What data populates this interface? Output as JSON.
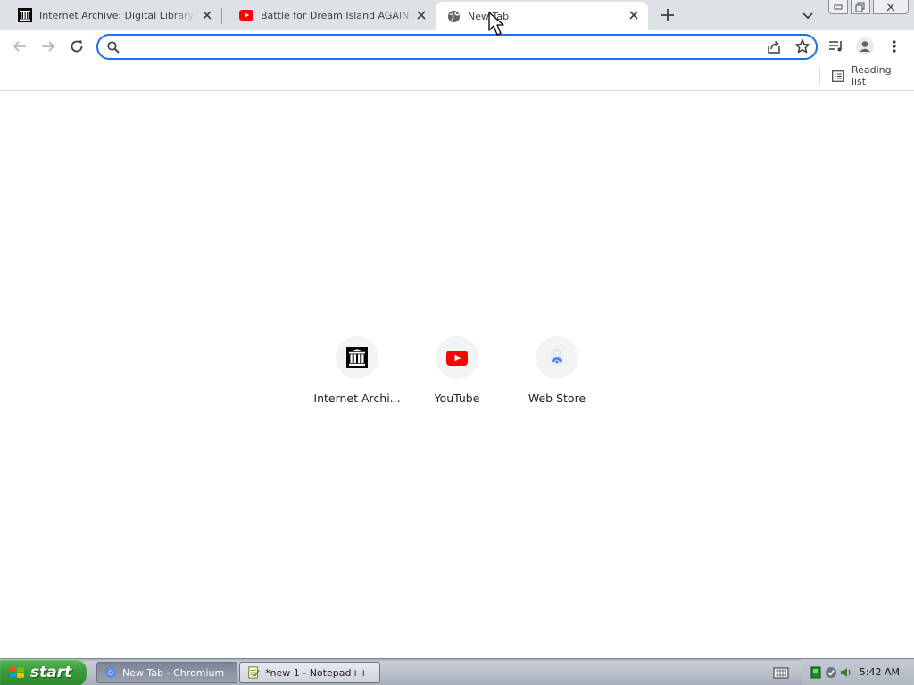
{
  "window": {
    "tabs": [
      {
        "title": "Internet Archive: Digital Library of Free",
        "icon": "archive-icon",
        "active": false
      },
      {
        "title": "Battle for Dream Island AGAIN - Season",
        "icon": "youtube-icon",
        "active": false
      },
      {
        "title": "New Tab",
        "icon": "globe-icon",
        "active": true
      }
    ],
    "controls": {
      "new_tab_icon": "plus-icon",
      "tab_search_icon": "chevron-down-icon"
    }
  },
  "toolbar": {
    "omnibox": {
      "value": "",
      "placeholder": ""
    }
  },
  "bookmarks_bar": {
    "reading_list_label": "Reading list"
  },
  "shortcuts": [
    {
      "label": "Internet Archi...",
      "icon": "archive-icon"
    },
    {
      "label": "YouTube",
      "icon": "youtube-icon"
    },
    {
      "label": "Web Store",
      "icon": "web-store-icon"
    }
  ],
  "taskbar": {
    "start_label": "start",
    "tasks": [
      {
        "label": "New Tab - Chromium",
        "active": true
      },
      {
        "label": "*new 1 - Notepad++",
        "active": false
      }
    ],
    "clock": "5:42 AM"
  },
  "colors": {
    "accent": "#1a73e8",
    "tabstrip": "#dee1e6",
    "youtube_red": "#ff0000",
    "start_green": "#3a9a3a"
  }
}
